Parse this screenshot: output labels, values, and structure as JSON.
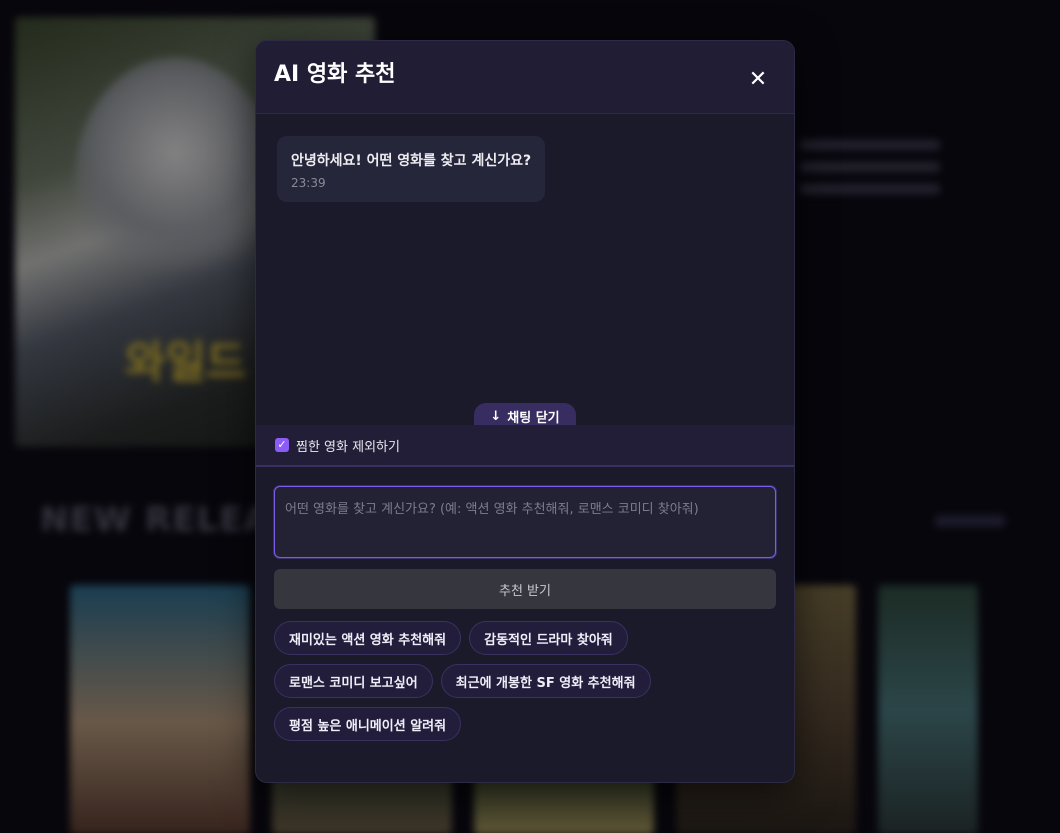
{
  "background": {
    "hero_title": "와일드 로봇",
    "section_title": "NEW RELEA"
  },
  "modal": {
    "title": "AI 영화 추천",
    "close_icon": "close-icon"
  },
  "chat": {
    "messages": [
      {
        "text": "안녕하세요! 어떤 영화를 찾고 계신가요?",
        "time": "23:39"
      }
    ],
    "close_chat_label": "채팅 닫기",
    "close_chat_icon": "arrow-down-icon"
  },
  "options": {
    "exclude_wishlist_label": "찜한 영화 제외하기",
    "exclude_wishlist_checked": true
  },
  "input": {
    "placeholder": "어떤 영화를 찾고 계신가요? (예: 액션 영화 추천해줘, 로맨스 코미디 찾아줘)",
    "value": ""
  },
  "submit_label": "추천 받기",
  "suggestions": [
    "재미있는 액션 영화 추천해줘",
    "감동적인 드라마 찾아줘",
    "로맨스 코미디 보고싶어",
    "최근에 개봉한 SF 영화 추천해줘",
    "평점 높은 애니메이션 알려줘"
  ],
  "colors": {
    "accent": "#8b5cf6",
    "modal_bg": "#1a1a2a",
    "header_bg": "#201d35"
  }
}
